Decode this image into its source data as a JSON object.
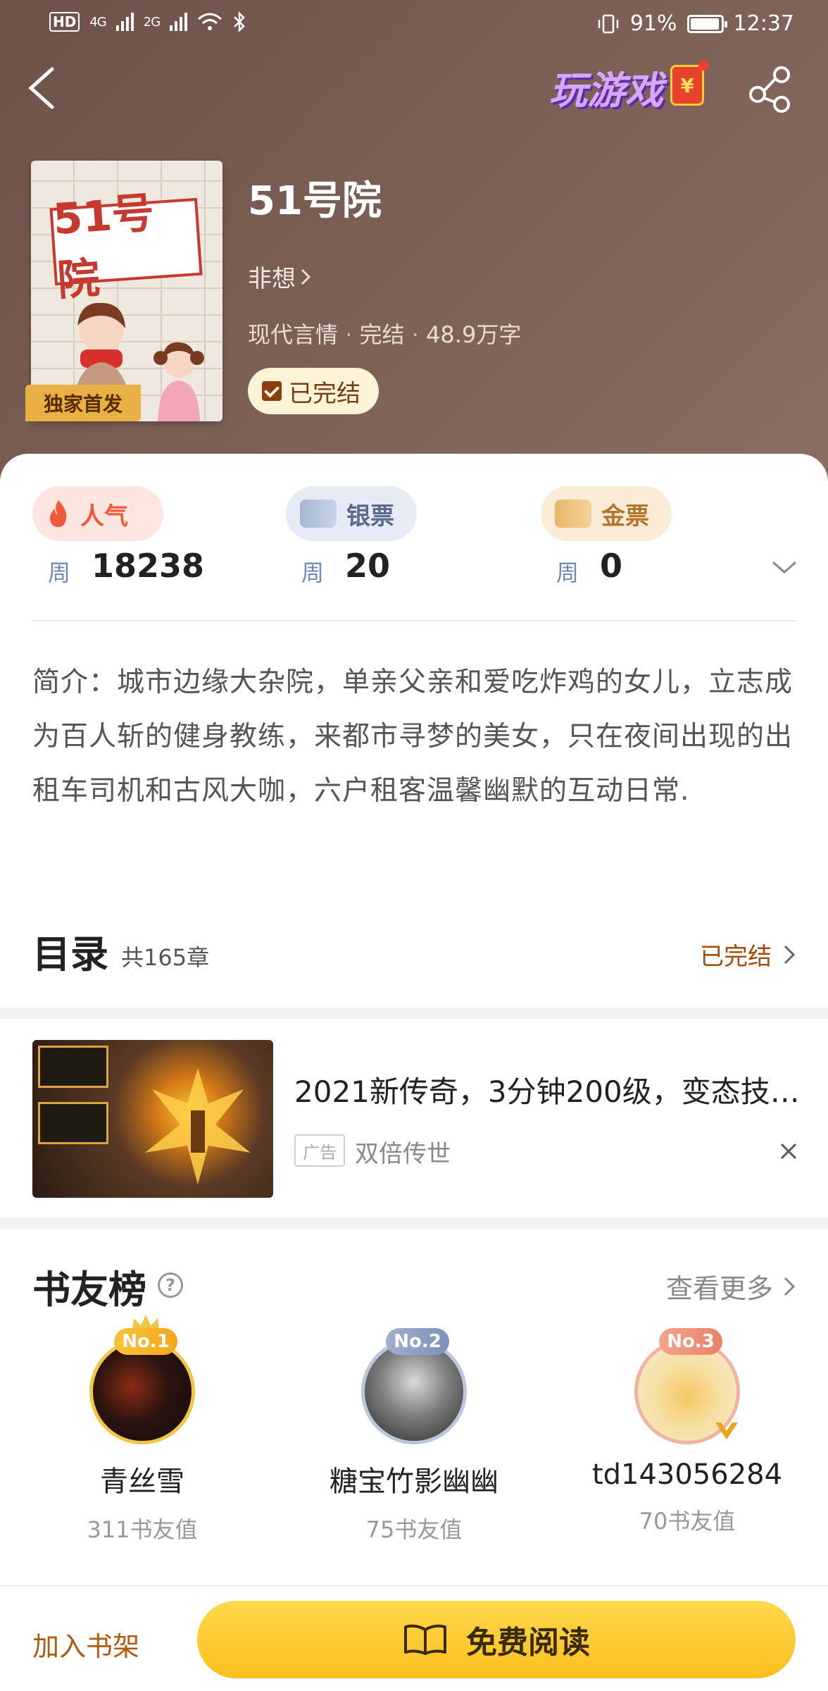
{
  "status_bar": {
    "left_badge": "HD",
    "sim1": "4G",
    "sim2": "2G",
    "battery_pct": "91%",
    "time": "12:37"
  },
  "header": {
    "game_banner": "玩游戏",
    "redpacket_symbol": "¥"
  },
  "book": {
    "title": "51号院",
    "cover_title": "51号院",
    "cover_badge": "独家首发",
    "author": "非想",
    "genre": "现代言情",
    "status": "完结",
    "word_count": "48.9万字",
    "completed_label": "已完结"
  },
  "stats": [
    {
      "label": "人气",
      "period": "周",
      "value": "18238"
    },
    {
      "label": "银票",
      "period": "周",
      "value": "20"
    },
    {
      "label": "金票",
      "period": "周",
      "value": "0"
    }
  ],
  "intro": {
    "text": "简介：城市边缘大杂院，单亲父亲和爱吃炸鸡的女儿，立志成为百人斩的健身教练，来都市寻梦的美女，只在夜间出现的出租车司机和古风大咖，六户租客温馨幽默的互动日常."
  },
  "toc": {
    "title": "目录",
    "count": "共165章",
    "status": "已完结"
  },
  "ad": {
    "title": "2021新传奇，3分钟200级，变态技…",
    "tag": "广告",
    "source": "双倍传世"
  },
  "ranking": {
    "title": "书友榜",
    "help": "?",
    "more": "查看更多",
    "fans": [
      {
        "rank": "No.1",
        "name": "青丝雪",
        "score": "311书友值"
      },
      {
        "rank": "No.2",
        "name": "糖宝竹影幽幽",
        "score": "75书友值"
      },
      {
        "rank": "No.3",
        "name": "td143056284",
        "score": "70书友值"
      }
    ]
  },
  "bottom": {
    "add_shelf": "加入书架",
    "read": "免费阅读"
  },
  "colors": {
    "header_bg": "#7b5f55",
    "accent_brown": "#a24b0a",
    "read_button": "#fcca2c",
    "hot": "#f0593a"
  }
}
